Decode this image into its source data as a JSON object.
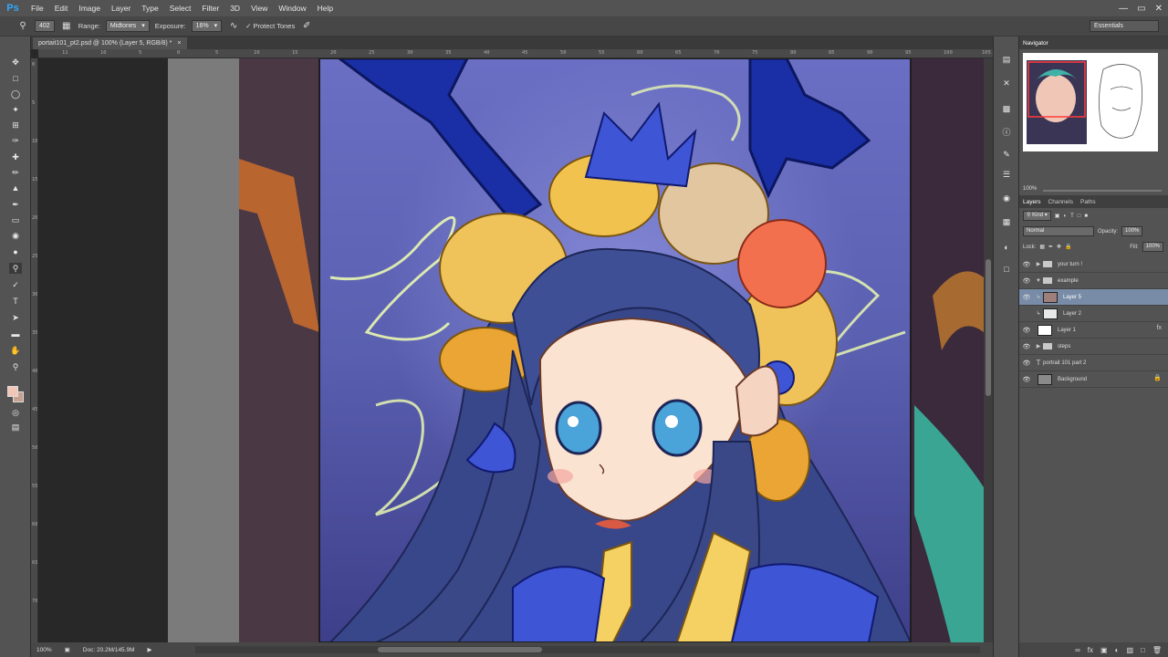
{
  "app": {
    "logo": "Ps"
  },
  "menu": [
    "File",
    "Edit",
    "Image",
    "Layer",
    "Type",
    "Select",
    "Filter",
    "3D",
    "View",
    "Window",
    "Help"
  ],
  "window_controls": [
    "—",
    "▭",
    "✕"
  ],
  "options_bar": {
    "brush_size": "402",
    "range_label": "Range:",
    "range_value": "Midtones",
    "exposure_label": "Exposure:",
    "exposure_value": "16%",
    "protect_tones_label": "Protect Tones",
    "workspace": "Essentials"
  },
  "document": {
    "tab_title": "portait101_pt2.psd @ 100% (Layer 5, RGB/8) *",
    "tab_close": "×",
    "ruler_top": [
      "11",
      "10",
      "5",
      "0",
      "5",
      "10",
      "15",
      "20",
      "25",
      "30",
      "35",
      "40",
      "45",
      "50",
      "55",
      "60",
      "65",
      "70",
      "75",
      "80",
      "85",
      "90",
      "95",
      "100",
      "105"
    ],
    "ruler_left": [
      "0",
      "5",
      "10",
      "15",
      "20",
      "25",
      "30",
      "35",
      "40",
      "45",
      "50",
      "55",
      "60",
      "65",
      "70"
    ]
  },
  "status": {
    "zoom": "100%",
    "doc_size": "Doc: 20.2M/145.9M"
  },
  "navigator": {
    "title": "Navigator",
    "zoom": "100%"
  },
  "layers": {
    "tabs": [
      "Layers",
      "Channels",
      "Paths"
    ],
    "kind_label": "Kind",
    "blend_mode": "Normal",
    "opacity_label": "Opacity:",
    "opacity_value": "100%",
    "lock_label": "Lock:",
    "fill_label": "Fill:",
    "fill_value": "100%",
    "items": [
      {
        "name": "your turn !",
        "type": "group",
        "expanded": false,
        "indent": 0
      },
      {
        "name": "example",
        "type": "group",
        "expanded": true,
        "indent": 0
      },
      {
        "name": "Layer 5",
        "type": "layer",
        "indent": 1,
        "selected": true
      },
      {
        "name": "Layer 2",
        "type": "layer",
        "indent": 1,
        "hidden": true
      },
      {
        "name": "Layer 1",
        "type": "layer",
        "indent": 0,
        "fx": "fx"
      },
      {
        "name": "steps",
        "type": "group",
        "expanded": false,
        "indent": 0
      },
      {
        "name": "portrait 101 part 2",
        "type": "text",
        "indent": 0
      },
      {
        "name": "Background",
        "type": "background",
        "indent": 0
      }
    ]
  },
  "colors": {
    "foreground": "#f2c6b6",
    "background": "#c7a08f",
    "accent_selection": "#788ca7"
  }
}
